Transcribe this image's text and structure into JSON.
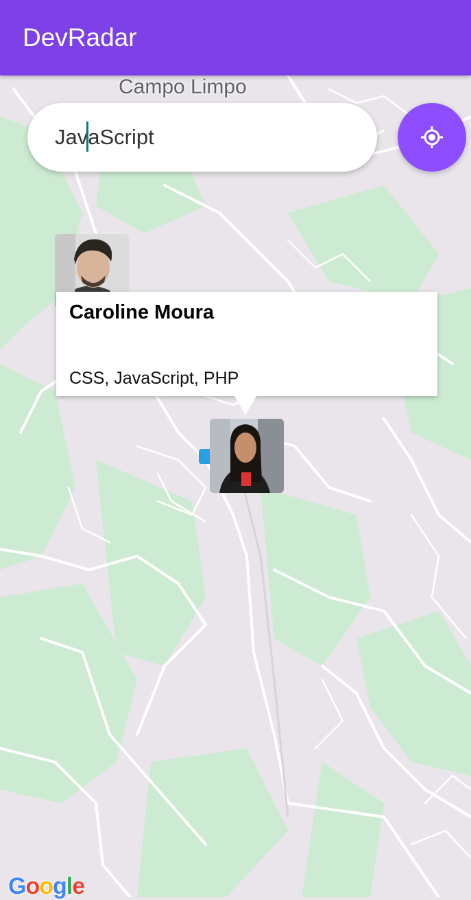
{
  "appbar": {
    "title": "DevRadar"
  },
  "map": {
    "place_label": "Campo Limpo",
    "attribution": "Google",
    "colors": {
      "land": "#e9e5ea",
      "park": "#cdebd2",
      "road": "#ffffff"
    }
  },
  "search": {
    "value": "JavaScript"
  },
  "locate_button": {
    "icon": "my-location-icon",
    "color": "#8e4dff"
  },
  "markers": [
    {
      "name": "dev-marker-1",
      "avatar": "avatar-photo"
    },
    {
      "name": "dev-marker-2",
      "avatar": "avatar-photo"
    }
  ],
  "callout": {
    "name": "Caroline Moura",
    "techs": "CSS, JavaScript, PHP"
  }
}
